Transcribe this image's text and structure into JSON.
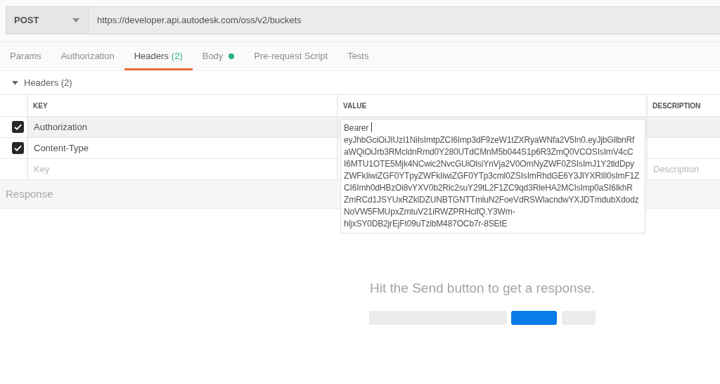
{
  "request": {
    "method": "POST",
    "url": "https://developer.api.autodesk.com/oss/v2/buckets"
  },
  "tabs": [
    {
      "label": "Params",
      "selected": false,
      "indicator": false
    },
    {
      "label": "Authorization",
      "selected": false,
      "indicator": false
    },
    {
      "label": "Headers",
      "count": "(2)",
      "selected": true,
      "indicator": false
    },
    {
      "label": "Body",
      "selected": false,
      "indicator": true
    },
    {
      "label": "Pre-request Script",
      "selected": false,
      "indicator": false
    },
    {
      "label": "Tests",
      "selected": false,
      "indicator": false
    }
  ],
  "headers_section": {
    "title": "Headers (2)",
    "expanded": true
  },
  "table": {
    "columns": [
      "KEY",
      "VALUE",
      "DESCRIPTION"
    ],
    "rows": [
      {
        "checked": true,
        "highlighted": true,
        "editing": true,
        "key": "Authorization",
        "value_lines": [
          "Bearer",
          "eyJhbGciOiJIUzI1NiIsImtpZCI6Imp3dF9zeW1tZXRyaWNfa2V5In0.eyJjbGllbnRf",
          "aWQiOiJrb3RMcldnRmd0Y280UTdCMnM5b044S1p6R3ZmQ0VCOSIsImV4cC",
          "I6MTU1OTE5Mjk4NCwic2NvcGUiOlsiYnVja2V0OmNyZWF0ZSIsImJ1Y2tldDpy",
          "ZWFkIiwiZGF0YTpyZWFkIiwiZGF0YTp3cml0ZSIsImRhdGE6Y3JlYXRlIl0sImF1Z",
          "CI6Imh0dHBzOi8vYXV0b2Rlc2suY29tL2F1ZC9qd3RleHA2MCIsImp0aSI6IkhR",
          "ZmRCd1JSYUxRZklDZUNBTGNTTmluN2FoeVdRSWlacndwYXJDTmdubXdodz",
          "NoVW5FMUpxZmtuV21iRWZPRHcifQ.Y3Wm-",
          "hljxSY0DB2jrEjFt09uTzibM487OCb7r-8SEtE"
        ]
      },
      {
        "checked": true,
        "highlighted": false,
        "editing": false,
        "key": "Content-Type"
      }
    ],
    "new_row": {
      "key_placeholder": "Key",
      "description_placeholder": "Description"
    }
  },
  "response": {
    "title": "Response",
    "empty_message": "Hit the Send button to get a response."
  }
}
